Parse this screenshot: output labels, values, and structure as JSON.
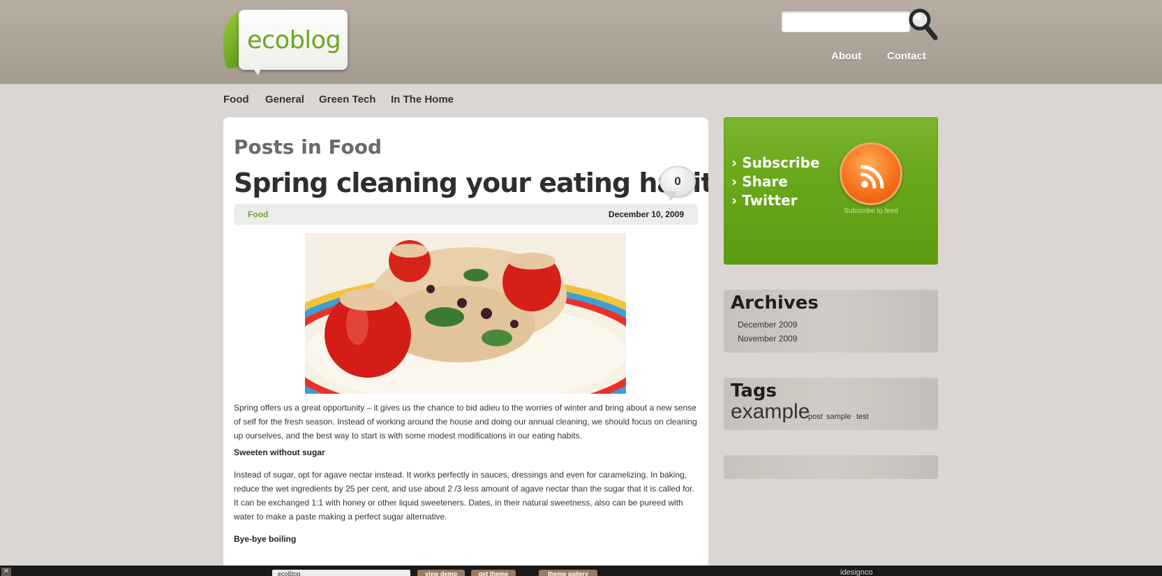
{
  "header": {
    "logo_text": "ecoblog",
    "search": {
      "value": "",
      "placeholder": ""
    },
    "nav": [
      "About",
      "Contact"
    ]
  },
  "categories": [
    "Food",
    "General",
    "Green Tech",
    "In The Home"
  ],
  "main": {
    "archive_heading": "Posts in Food",
    "post": {
      "title": "Spring cleaning your eating habits",
      "comment_count": "0",
      "category": "Food",
      "date": "December 10, 2009",
      "paragraphs": [
        "Spring offers us a great opportunity – it gives us the chance to bid adieu to the worries of winter and bring about a new sense of self for the fresh season. Instead of working around the house and doing our annual cleaning, we should focus on cleaning up ourselves, and the best way to start is with some modest modifications in our eating habits.",
        "Sweeten without sugar",
        "Instead of sugar, opt for agave nectar instead. It works perfectly in sauces, dressings and even for caramelizing. In baking, reduce the wet ingredients by 25 per cent, and use about 2 /3 less amount of agave nectar than the sugar that it is called for. It can be exchanged 1:1 with honey or other liquid sweeteners. Dates, in their natural sweetness, also can be pureed with water to make a paste making a perfect sugar alternative.",
        "Bye-bye boiling"
      ]
    }
  },
  "sidebar": {
    "subscribe_links": [
      "Subscribe",
      "Share",
      "Twitter"
    ],
    "subscribe_caption": "Subscribe to feed",
    "archives": {
      "title": "Archives",
      "items": [
        "December 2009",
        "November 2009"
      ]
    },
    "tags": {
      "title": "Tags",
      "items": [
        "example",
        "post",
        "sample",
        "test"
      ]
    }
  },
  "bottom_bar": {
    "theme_select": "ecoBlog",
    "buttons": [
      "view demo",
      "get theme",
      "theme gallery"
    ],
    "brand": "idesignco"
  }
}
